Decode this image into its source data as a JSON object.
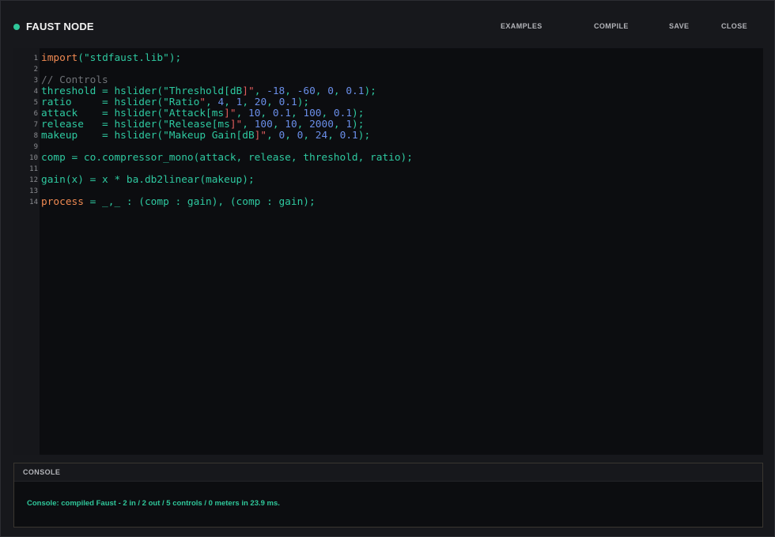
{
  "header": {
    "title": "FAUST NODE",
    "status_color": "#2fc79a",
    "buttons": {
      "examples": "EXAMPLES",
      "compile": "COMPILE",
      "save": "SAVE",
      "close": "CLOSE"
    }
  },
  "editor": {
    "line_numbers": [
      "1",
      "2",
      "3",
      "4",
      "5",
      "6",
      "7",
      "8",
      "9",
      "10",
      "11",
      "12",
      "13",
      "14"
    ],
    "lines": [
      [
        {
          "t": "kw",
          "v": "import"
        },
        {
          "t": "p",
          "v": "("
        },
        {
          "t": "str",
          "v": "\"stdfaust.lib\""
        },
        {
          "t": "p",
          "v": ");"
        }
      ],
      [],
      [
        {
          "t": "cmt",
          "v": "// Controls"
        }
      ],
      [
        {
          "t": "id",
          "v": "threshold = hslider("
        },
        {
          "t": "str",
          "v": "\"Threshold[dB"
        },
        {
          "t": "q",
          "v": "]\""
        },
        {
          "t": "p",
          "v": ", "
        },
        {
          "t": "num",
          "v": "-18"
        },
        {
          "t": "p",
          "v": ", "
        },
        {
          "t": "num",
          "v": "-60"
        },
        {
          "t": "p",
          "v": ", "
        },
        {
          "t": "num",
          "v": "0"
        },
        {
          "t": "p",
          "v": ", "
        },
        {
          "t": "num",
          "v": "0.1"
        },
        {
          "t": "p",
          "v": ");"
        }
      ],
      [
        {
          "t": "id",
          "v": "ratio     = hslider("
        },
        {
          "t": "str",
          "v": "\"Ratio"
        },
        {
          "t": "q",
          "v": "\""
        },
        {
          "t": "p",
          "v": ", "
        },
        {
          "t": "num",
          "v": "4"
        },
        {
          "t": "p",
          "v": ", "
        },
        {
          "t": "num",
          "v": "1"
        },
        {
          "t": "p",
          "v": ", "
        },
        {
          "t": "num",
          "v": "20"
        },
        {
          "t": "p",
          "v": ", "
        },
        {
          "t": "num",
          "v": "0.1"
        },
        {
          "t": "p",
          "v": ");"
        }
      ],
      [
        {
          "t": "id",
          "v": "attack    = hslider("
        },
        {
          "t": "str",
          "v": "\"Attack[ms"
        },
        {
          "t": "q",
          "v": "]\""
        },
        {
          "t": "p",
          "v": ", "
        },
        {
          "t": "num",
          "v": "10"
        },
        {
          "t": "p",
          "v": ", "
        },
        {
          "t": "num",
          "v": "0.1"
        },
        {
          "t": "p",
          "v": ", "
        },
        {
          "t": "num",
          "v": "100"
        },
        {
          "t": "p",
          "v": ", "
        },
        {
          "t": "num",
          "v": "0.1"
        },
        {
          "t": "p",
          "v": ");"
        }
      ],
      [
        {
          "t": "id",
          "v": "release   = hslider("
        },
        {
          "t": "str",
          "v": "\"Release[ms"
        },
        {
          "t": "q",
          "v": "]\""
        },
        {
          "t": "p",
          "v": ", "
        },
        {
          "t": "num",
          "v": "100"
        },
        {
          "t": "p",
          "v": ", "
        },
        {
          "t": "num",
          "v": "10"
        },
        {
          "t": "p",
          "v": ", "
        },
        {
          "t": "num",
          "v": "2000"
        },
        {
          "t": "p",
          "v": ", "
        },
        {
          "t": "num",
          "v": "1"
        },
        {
          "t": "p",
          "v": ");"
        }
      ],
      [
        {
          "t": "id",
          "v": "makeup    = hslider("
        },
        {
          "t": "str",
          "v": "\"Makeup Gain[dB"
        },
        {
          "t": "q",
          "v": "]\""
        },
        {
          "t": "p",
          "v": ", "
        },
        {
          "t": "num",
          "v": "0"
        },
        {
          "t": "p",
          "v": ", "
        },
        {
          "t": "num",
          "v": "0"
        },
        {
          "t": "p",
          "v": ", "
        },
        {
          "t": "num",
          "v": "24"
        },
        {
          "t": "p",
          "v": ", "
        },
        {
          "t": "num",
          "v": "0.1"
        },
        {
          "t": "p",
          "v": ");"
        }
      ],
      [],
      [
        {
          "t": "id",
          "v": "comp = co.compressor_mono(attack, release, threshold, ratio);"
        }
      ],
      [],
      [
        {
          "t": "id",
          "v": "gain(x) = x * ba.db2linear(makeup);"
        }
      ],
      [],
      [
        {
          "t": "kw",
          "v": "process"
        },
        {
          "t": "id",
          "v": " = _,_ : (comp : gain), (comp : gain);"
        }
      ]
    ]
  },
  "console": {
    "title": "CONSOLE",
    "message": "Console: compiled Faust - 2 in / 2 out / 5 controls / 0 meters in 23.9 ms."
  }
}
